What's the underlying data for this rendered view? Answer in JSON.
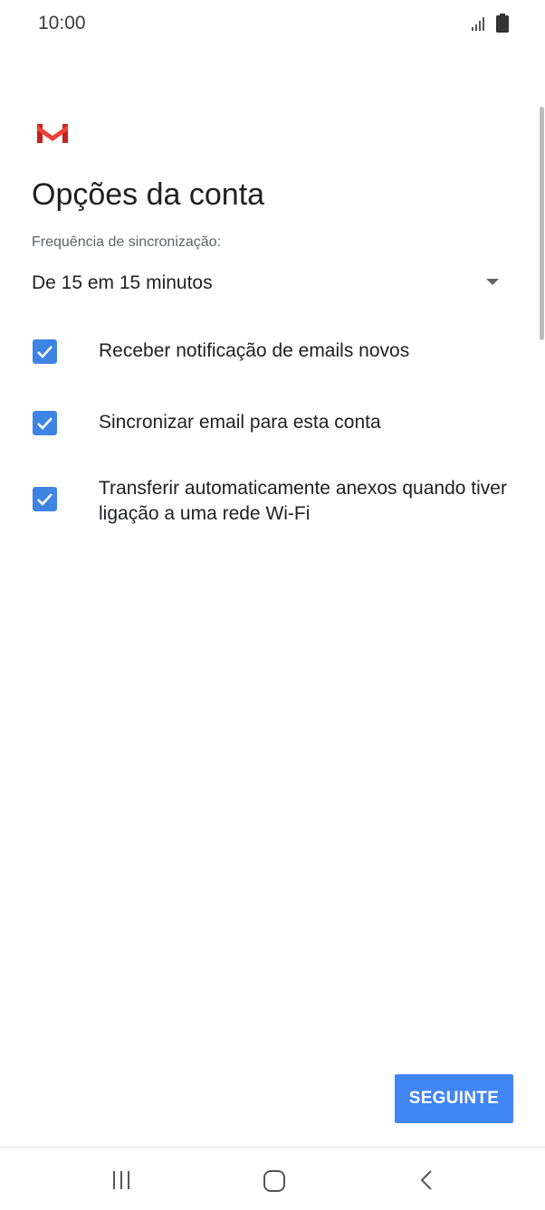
{
  "status_bar": {
    "time": "10:00"
  },
  "brand": {
    "logo_icon": "gmail-logo-icon",
    "colors": {
      "red": "#ea4335",
      "accent": "#4285f4",
      "checkbox": "#3f84e5"
    }
  },
  "page": {
    "title": "Opções da conta",
    "sync_frequency": {
      "label": "Frequência de sincronização:",
      "selected": "De 15 em 15 minutos"
    },
    "options": [
      {
        "label": "Receber notificação de emails novos",
        "checked": true
      },
      {
        "label": "Sincronizar email para esta conta",
        "checked": true
      },
      {
        "label": "Transferir automaticamente anexos quando tiver ligação a uma rede Wi-Fi",
        "checked": true
      }
    ],
    "next_button": "SEGUINTE"
  },
  "nav_bar": {
    "icons": [
      "recents-icon",
      "home-icon",
      "back-icon"
    ]
  }
}
